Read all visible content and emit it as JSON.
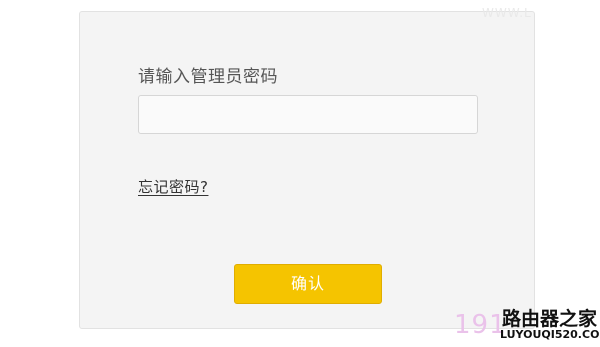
{
  "login": {
    "prompt": "请输入管理员密码",
    "password_value": "",
    "forgot_link": "忘记密码?",
    "confirm_label": "确认"
  },
  "watermark": {
    "top_text": "WWW.L",
    "digits": "191",
    "logo_cn": "路由器之家",
    "logo_en": "LUYOUQI520.COM"
  },
  "colors": {
    "confirm_button": "#f5c400",
    "card_background": "#f4f4f4"
  }
}
